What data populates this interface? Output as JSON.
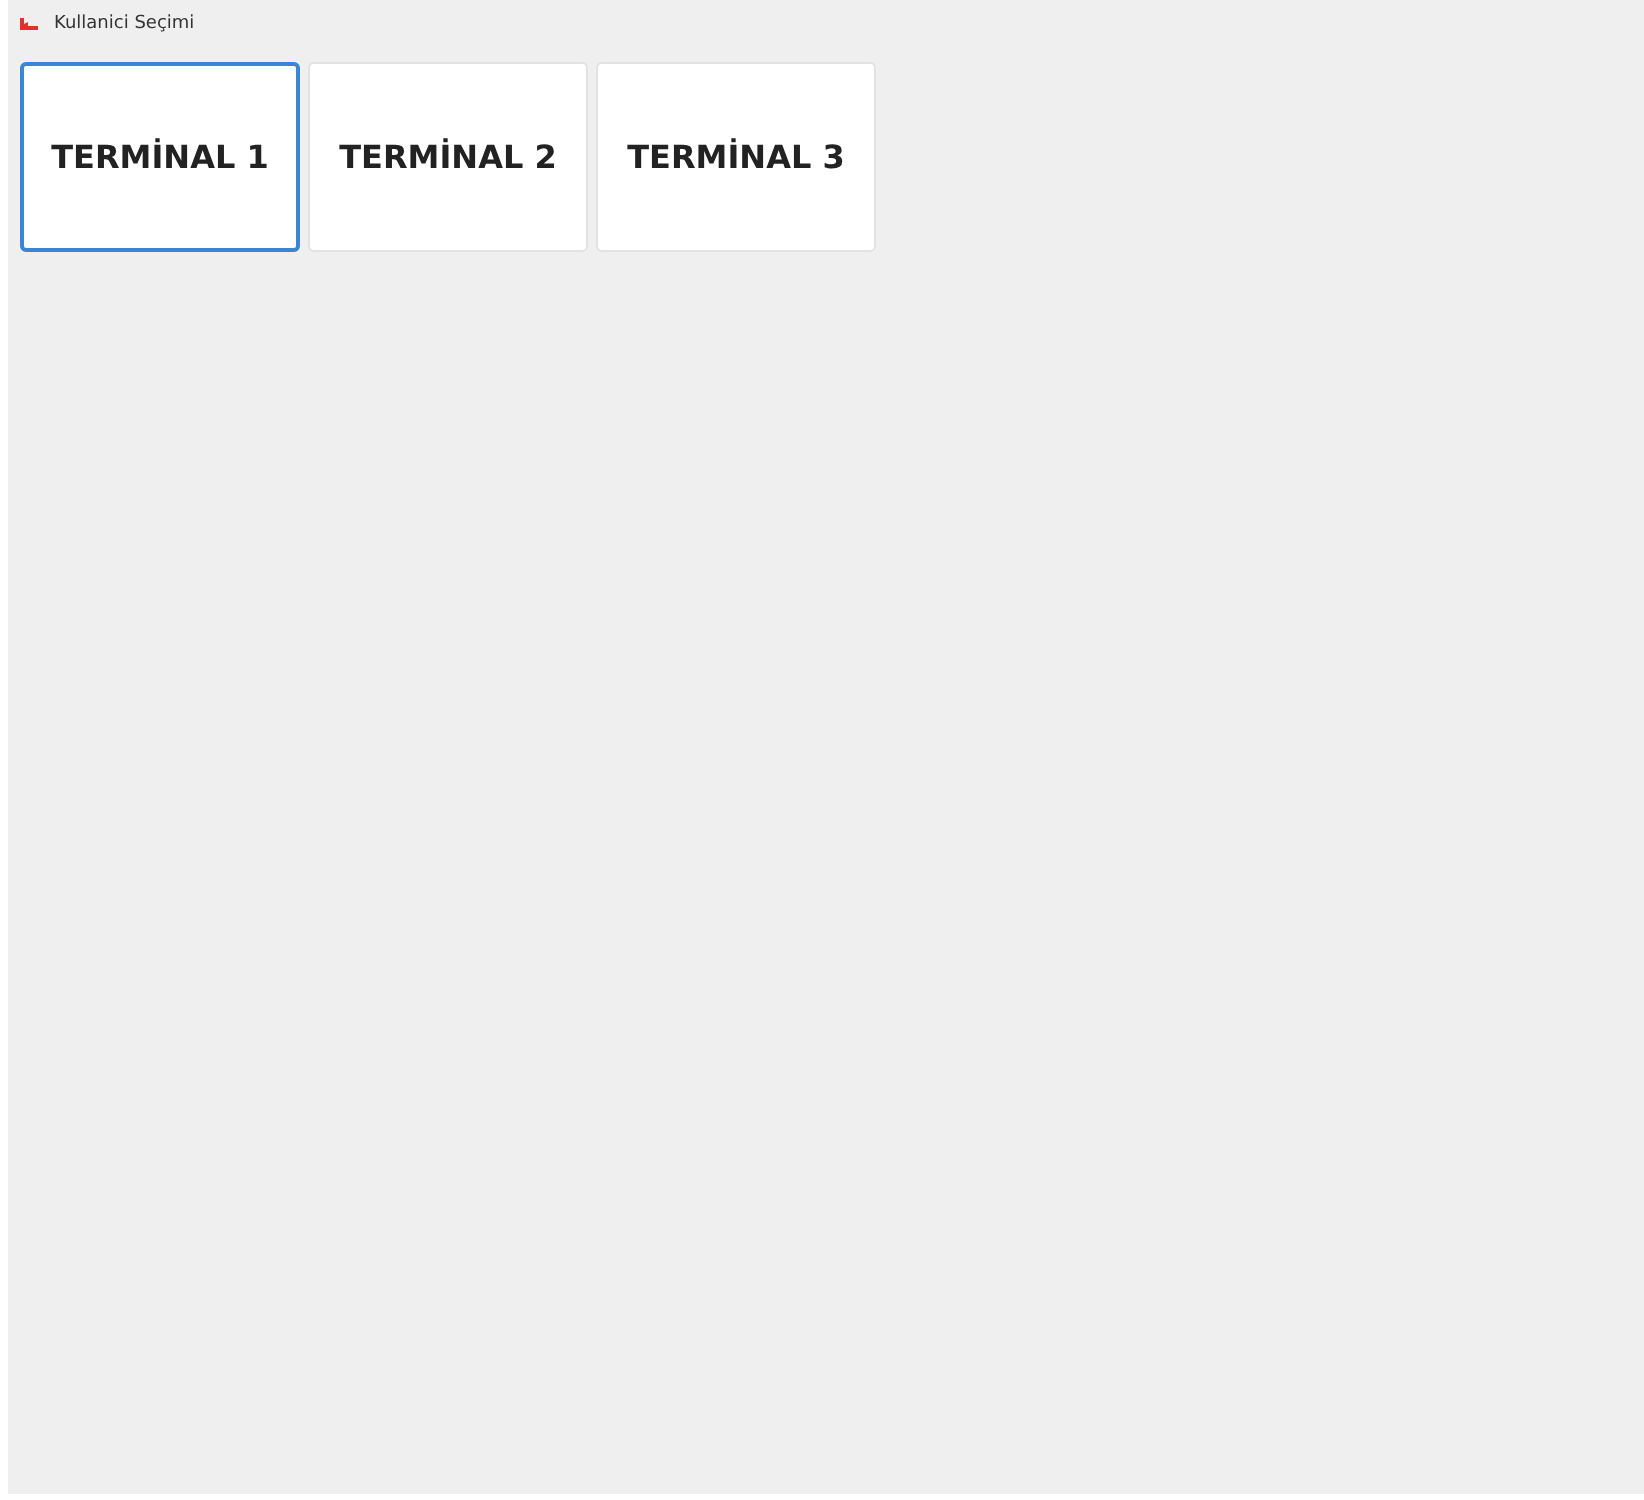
{
  "header": {
    "title": "Kullanici Seçimi"
  },
  "terminals": [
    {
      "label": "TERMİNAL 1",
      "selected": true
    },
    {
      "label": "TERMİNAL 2",
      "selected": false
    },
    {
      "label": "TERMİNAL 3",
      "selected": false
    }
  ]
}
